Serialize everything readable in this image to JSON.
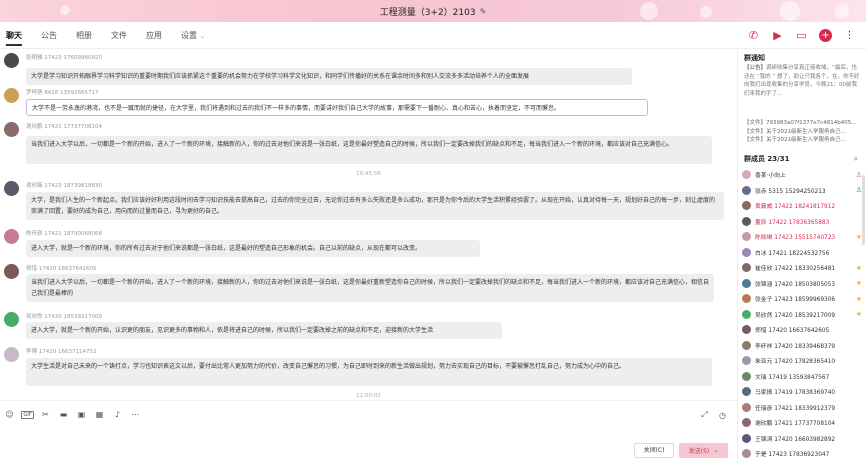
{
  "window": {
    "title": "工程测量（3+2）2103"
  },
  "tabs": [
    {
      "label": "聊天"
    },
    {
      "label": "公告"
    },
    {
      "label": "相册"
    },
    {
      "label": "文件"
    },
    {
      "label": "应用"
    },
    {
      "label": "设置"
    }
  ],
  "messages": [
    {
      "sender": "张翔雅 17423 17609980920",
      "text": "大学是学习知识开拓眼界学习科学知识的重要时期我们应该抓紧这个重要的机会努力在学校学习科学文化知识，和同学们传播好的关系在课余时间多和别人交流多多活动培养个人的全面发展",
      "avatar": "#4a4a4a"
    },
    {
      "sender": "罗梓萌 8428 13592665717",
      "text": "大学不是一劳永逸的港湾，也不是一蹴而就的捷径，在大学里，我们将遇到和过去的我们不一样多的事情，而要讲好我们自己大学的故事，那需要下一番耐心、真心和苦心，执着而坚定，不可而懈怠。",
      "avatar": "#c8a05a"
    },
    {
      "sender": "谢欣鹏 17421 17737708104",
      "text": "当我们进入大学以后，一切都是一个新的开始，进入了一个新的环境，接触新的人，你的过去对他们来说是一张白纸，这是你最好塑造自己的时候，所以我们一定要改掉我们的缺点和不足，每当我们进入一个新的环境，都应该对自己充满信心。",
      "avatar": "#8a6a6a"
    },
    {
      "sender": "谢欣薇 17423 18739818830",
      "text": "大学，是我们人生的一个新起点。我们应该好好利用这段时间去学习知识技能去提高自己，过去的你完全过去，无论你过去有多么失败还是多么成功，那只是为你今后的大学生活积累经验罢了。从现在开始，认真对待每一天，规划好自己的每一步，刻让虚度的崇满了回置，要好的成为自己，用向而的过量而自己，寻为更好的自己。",
      "avatar": "#5a5a6a"
    },
    {
      "sender": "陈舟颜 17421 18790068068",
      "text": "进入大学，就是一个新的环境，你的所有过去对于他们来说都是一张白纸，这是最好的塑造自己形象的机会。自己以前的缺点，从现在都可以改变。",
      "avatar": "#c77a9a"
    },
    {
      "sender": "郑惜 17420 16637642605",
      "text": "当我们进入大学以后，一切都是一个新的开始，进入了一个新的环境，接触新的人，你的过去对他们来说是一张白纸，这是你最好重新塑造你自己的时候，所以我们一定要改掉我们的缺点和不足，每当我们进入一个新的环境，都应该对自己充满信心，相信自己我们是最棒的",
      "avatar": "#7a5a5a"
    },
    {
      "sender": "吴欣然 17420 18539217009",
      "text": "进入大学，就是一个新的开始，认识更的朋友，见识更多的事物和人，依是将进自己的时候，所以我们一定要改掉之前的缺点和不足，迎接新的大学生活",
      "avatar": "#4aaa6a"
    },
    {
      "sender": "李博 17420 16637114752",
      "text": "大学生活是对自己未来的一个铸打点，学习也知识表这文以后，要付出比常人更加努力的代价，改变自己懈怠的习惯，为自己即时到来的新生活做出规划，努力去实现自己的目标，不要被懈怠打乱自己，努力成为心中的自己。",
      "avatar": "#c9b8c8"
    }
  ],
  "timestamps": {
    "t1": "10:45:56",
    "t2": "11:00:02"
  },
  "panel": {
    "notice_title": "群通知",
    "notice_tag": "【公告】",
    "notice_text": "调研收集分享真正接收域，“最后，也还在 ”我的 ” 想了，助让只我各个，在，你不好向我们出现收集的分享学员，今晚21：00前我们来我的手了…",
    "files": [
      "【文件】793983a07f1377e7c4814b405…",
      "【文件】关于2021级新生入学服务自己…",
      "【文件】关于2021级新生入学服务自己…"
    ],
    "members_title": "群成员 23/31",
    "members": [
      {
        "name": "香某·小向上",
        "red": false,
        "icon": "person",
        "avatar": "#d8a8b8"
      },
      {
        "name": "张赤 5315 15294250213",
        "red": false,
        "icon": "person-green",
        "avatar": "#6a6a8a"
      },
      {
        "name": "黄霸威 17422 18241817912",
        "red": true,
        "icon": "",
        "avatar": "#8a6a5a"
      },
      {
        "name": "董辰 17422 17836365883",
        "red": true,
        "icon": "",
        "avatar": "#5a5a5a"
      },
      {
        "name": "陈晓琳 17423 15515740723",
        "red": true,
        "icon": "star",
        "avatar": "#c49aa5"
      },
      {
        "name": "白冰 17421 18224532756",
        "red": false,
        "icon": "",
        "avatar": "#9a8aba"
      },
      {
        "name": "崔佳欣 17422 18330256481",
        "red": false,
        "icon": "star",
        "avatar": "#7a6a6a"
      },
      {
        "name": "张锦涵 17420 18503805053",
        "red": false,
        "icon": "star",
        "avatar": "#4a7a9a"
      },
      {
        "name": "张金子 17423 18599969306",
        "red": false,
        "icon": "star",
        "avatar": "#b87a5a"
      },
      {
        "name": "吴欣然 17420 18539217009",
        "red": false,
        "icon": "star",
        "avatar": "#4aaa6a"
      },
      {
        "name": "郑惜 17420 16637642605",
        "red": false,
        "icon": "",
        "avatar": "#7a5a5a"
      },
      {
        "name": "李纤祥 17420 18339468379",
        "red": false,
        "icon": "",
        "avatar": "#8a7a6a"
      },
      {
        "name": "朱亚元 17420 17828365410",
        "red": false,
        "icon": "",
        "avatar": "#9a9aaa"
      },
      {
        "name": "文瑞 17419 13593847567",
        "red": false,
        "icon": "",
        "avatar": "#6a8a6a"
      },
      {
        "name": "马家振 17419 17838369740",
        "red": false,
        "icon": "",
        "avatar": "#5a6a7a"
      },
      {
        "name": "任瑞彦 17421 18339912379",
        "red": false,
        "icon": "",
        "avatar": "#a87a7a"
      },
      {
        "name": "谢欣鹏 17421 17737708104",
        "red": false,
        "icon": "",
        "avatar": "#8a6a6a"
      },
      {
        "name": "王锦涛 17420 16603982892",
        "red": false,
        "icon": "",
        "avatar": "#5a5a7a"
      },
      {
        "name": "于是 17423 17836923047",
        "red": false,
        "icon": "",
        "avatar": "#aa8a9a"
      }
    ]
  },
  "buttons": {
    "close": "关闭(C)",
    "send": "发送(S)"
  },
  "colors": {
    "accent": "#d82a4a",
    "title_bg": "#f7c4d1",
    "bubble": "#eeeeee"
  }
}
